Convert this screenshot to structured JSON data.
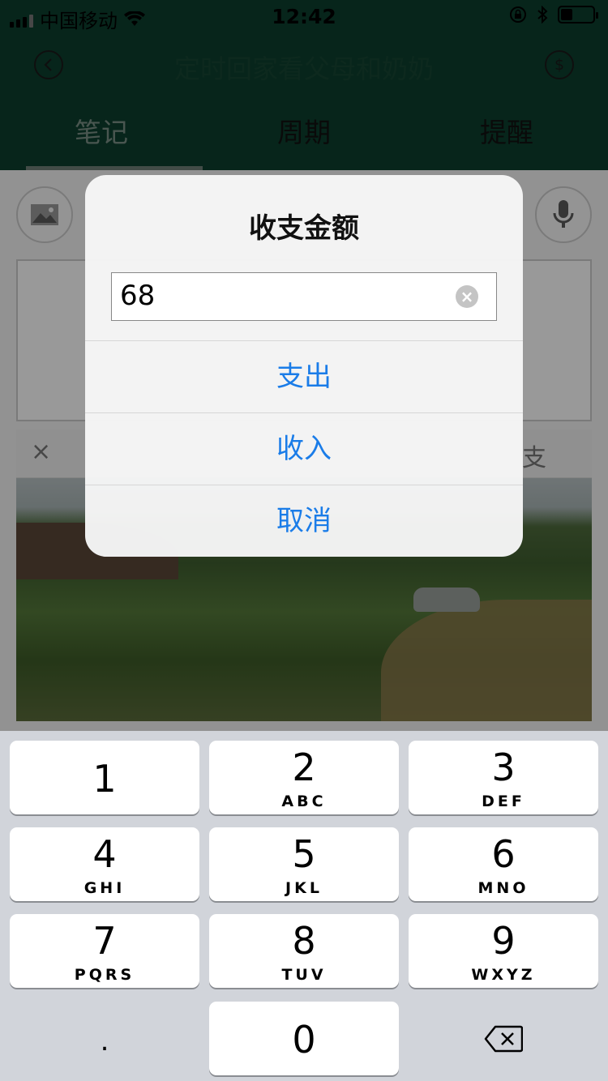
{
  "status_bar": {
    "carrier": "中国移动",
    "time": "12:42"
  },
  "nav": {
    "title": "定时回家看父母和奶奶",
    "back_icon": "chevron-left-circle-icon",
    "right_icon": "dollar-circle-icon",
    "tabs": [
      {
        "label": "笔记",
        "active": true
      },
      {
        "label": "周期",
        "active": false
      },
      {
        "label": "提醒",
        "active": false
      }
    ]
  },
  "content": {
    "image_button_icon": "image-icon",
    "mic_button_icon": "microphone-icon",
    "close_label": "×",
    "partial_label": "支"
  },
  "dialog": {
    "title": "收支金额",
    "input_value": "68",
    "buttons": [
      {
        "label": "支出"
      },
      {
        "label": "收入"
      },
      {
        "label": "取消"
      }
    ]
  },
  "keyboard": {
    "keys": [
      {
        "num": "1",
        "letters": ""
      },
      {
        "num": "2",
        "letters": "ABC"
      },
      {
        "num": "3",
        "letters": "DEF"
      },
      {
        "num": "4",
        "letters": "GHI"
      },
      {
        "num": "5",
        "letters": "JKL"
      },
      {
        "num": "6",
        "letters": "MNO"
      },
      {
        "num": "7",
        "letters": "PQRS"
      },
      {
        "num": "8",
        "letters": "TUV"
      },
      {
        "num": "9",
        "letters": "WXYZ"
      },
      {
        "num": "0",
        "letters": ""
      }
    ],
    "dot": ".",
    "delete_icon": "backspace-icon"
  },
  "colors": {
    "nav_bg": "#0d3f2e",
    "accent_blue": "#1a7ce8",
    "keyboard_bg": "#d1d4da"
  }
}
